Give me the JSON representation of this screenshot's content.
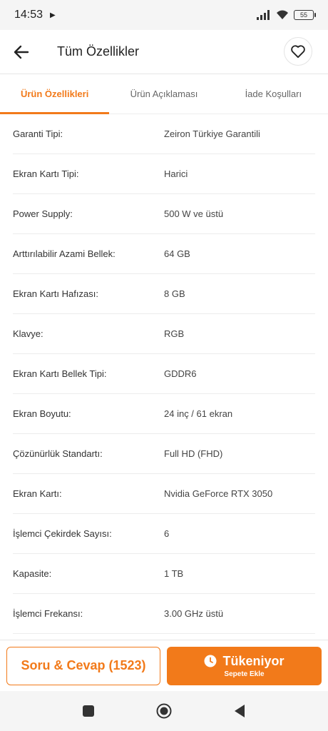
{
  "status_bar": {
    "time": "14:53",
    "battery": "55",
    "icons": [
      "play-icon",
      "signal-icon",
      "wifi-icon",
      "battery-icon"
    ]
  },
  "header": {
    "title": "Tüm Özellikler",
    "back_icon": "arrow-left-icon",
    "favorite_icon": "heart-icon"
  },
  "tabs": [
    {
      "label": "Ürün Özellikleri",
      "active": true
    },
    {
      "label": "Ürün Açıklaması",
      "active": false
    },
    {
      "label": "İade Koşulları",
      "active": false
    }
  ],
  "specs": [
    {
      "label": "Garanti Tipi:",
      "value": "Zeiron Türkiye Garantili"
    },
    {
      "label": "Ekran Kartı Tipi:",
      "value": "Harici"
    },
    {
      "label": "Power Supply:",
      "value": "500 W ve üstü"
    },
    {
      "label": "Arttırılabilir Azami Bellek:",
      "value": "64 GB"
    },
    {
      "label": "Ekran Kartı Hafızası:",
      "value": "8 GB"
    },
    {
      "label": "Klavye:",
      "value": "RGB"
    },
    {
      "label": "Ekran Kartı Bellek Tipi:",
      "value": "GDDR6"
    },
    {
      "label": "Ekran Boyutu:",
      "value": "24 inç / 61 ekran"
    },
    {
      "label": "Çözünürlük Standartı:",
      "value": "Full HD (FHD)"
    },
    {
      "label": "Ekran Kartı:",
      "value": "Nvidia GeForce RTX 3050"
    },
    {
      "label": "İşlemci Çekirdek Sayısı:",
      "value": "6"
    },
    {
      "label": "Kapasite:",
      "value": "1 TB"
    },
    {
      "label": "İşlemci Frekansı:",
      "value": "3.00 GHz üstü"
    }
  ],
  "bottom_bar": {
    "qa_label": "Soru & Cevap (1523)",
    "cart_title": "Tükeniyor",
    "cart_sub": "Sepete Ekle",
    "clock_icon": "clock-icon"
  },
  "colors": {
    "accent": "#f27a1a",
    "divider": "#ececec"
  },
  "nav_bar": {
    "icons": [
      "recents-square-icon",
      "home-circle-icon",
      "back-triangle-icon"
    ]
  }
}
